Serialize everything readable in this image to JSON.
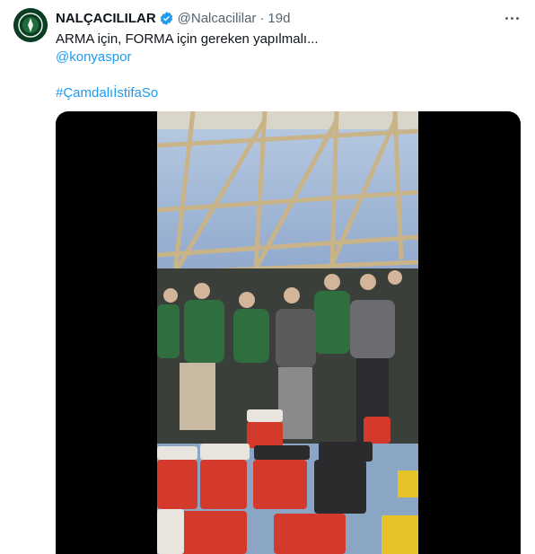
{
  "tweet": {
    "display_name": "NALÇACILILAR",
    "handle": "@Nalcacililar",
    "separator": "·",
    "timestamp": "19d",
    "text_line": "ARMA için, FORMA için gereken yapılmalı...",
    "mention": "@konyaspor",
    "hashtag": "#ÇamdalıİstifaSo"
  },
  "icons": {
    "verified": "verified-badge-icon",
    "more": "more-options-icon"
  },
  "colors": {
    "link": "#1d9bf0",
    "secondary_text": "#536471",
    "verified": "#1d9bf0",
    "avatar_bg": "#0b3d23",
    "media_bg": "#000000"
  }
}
